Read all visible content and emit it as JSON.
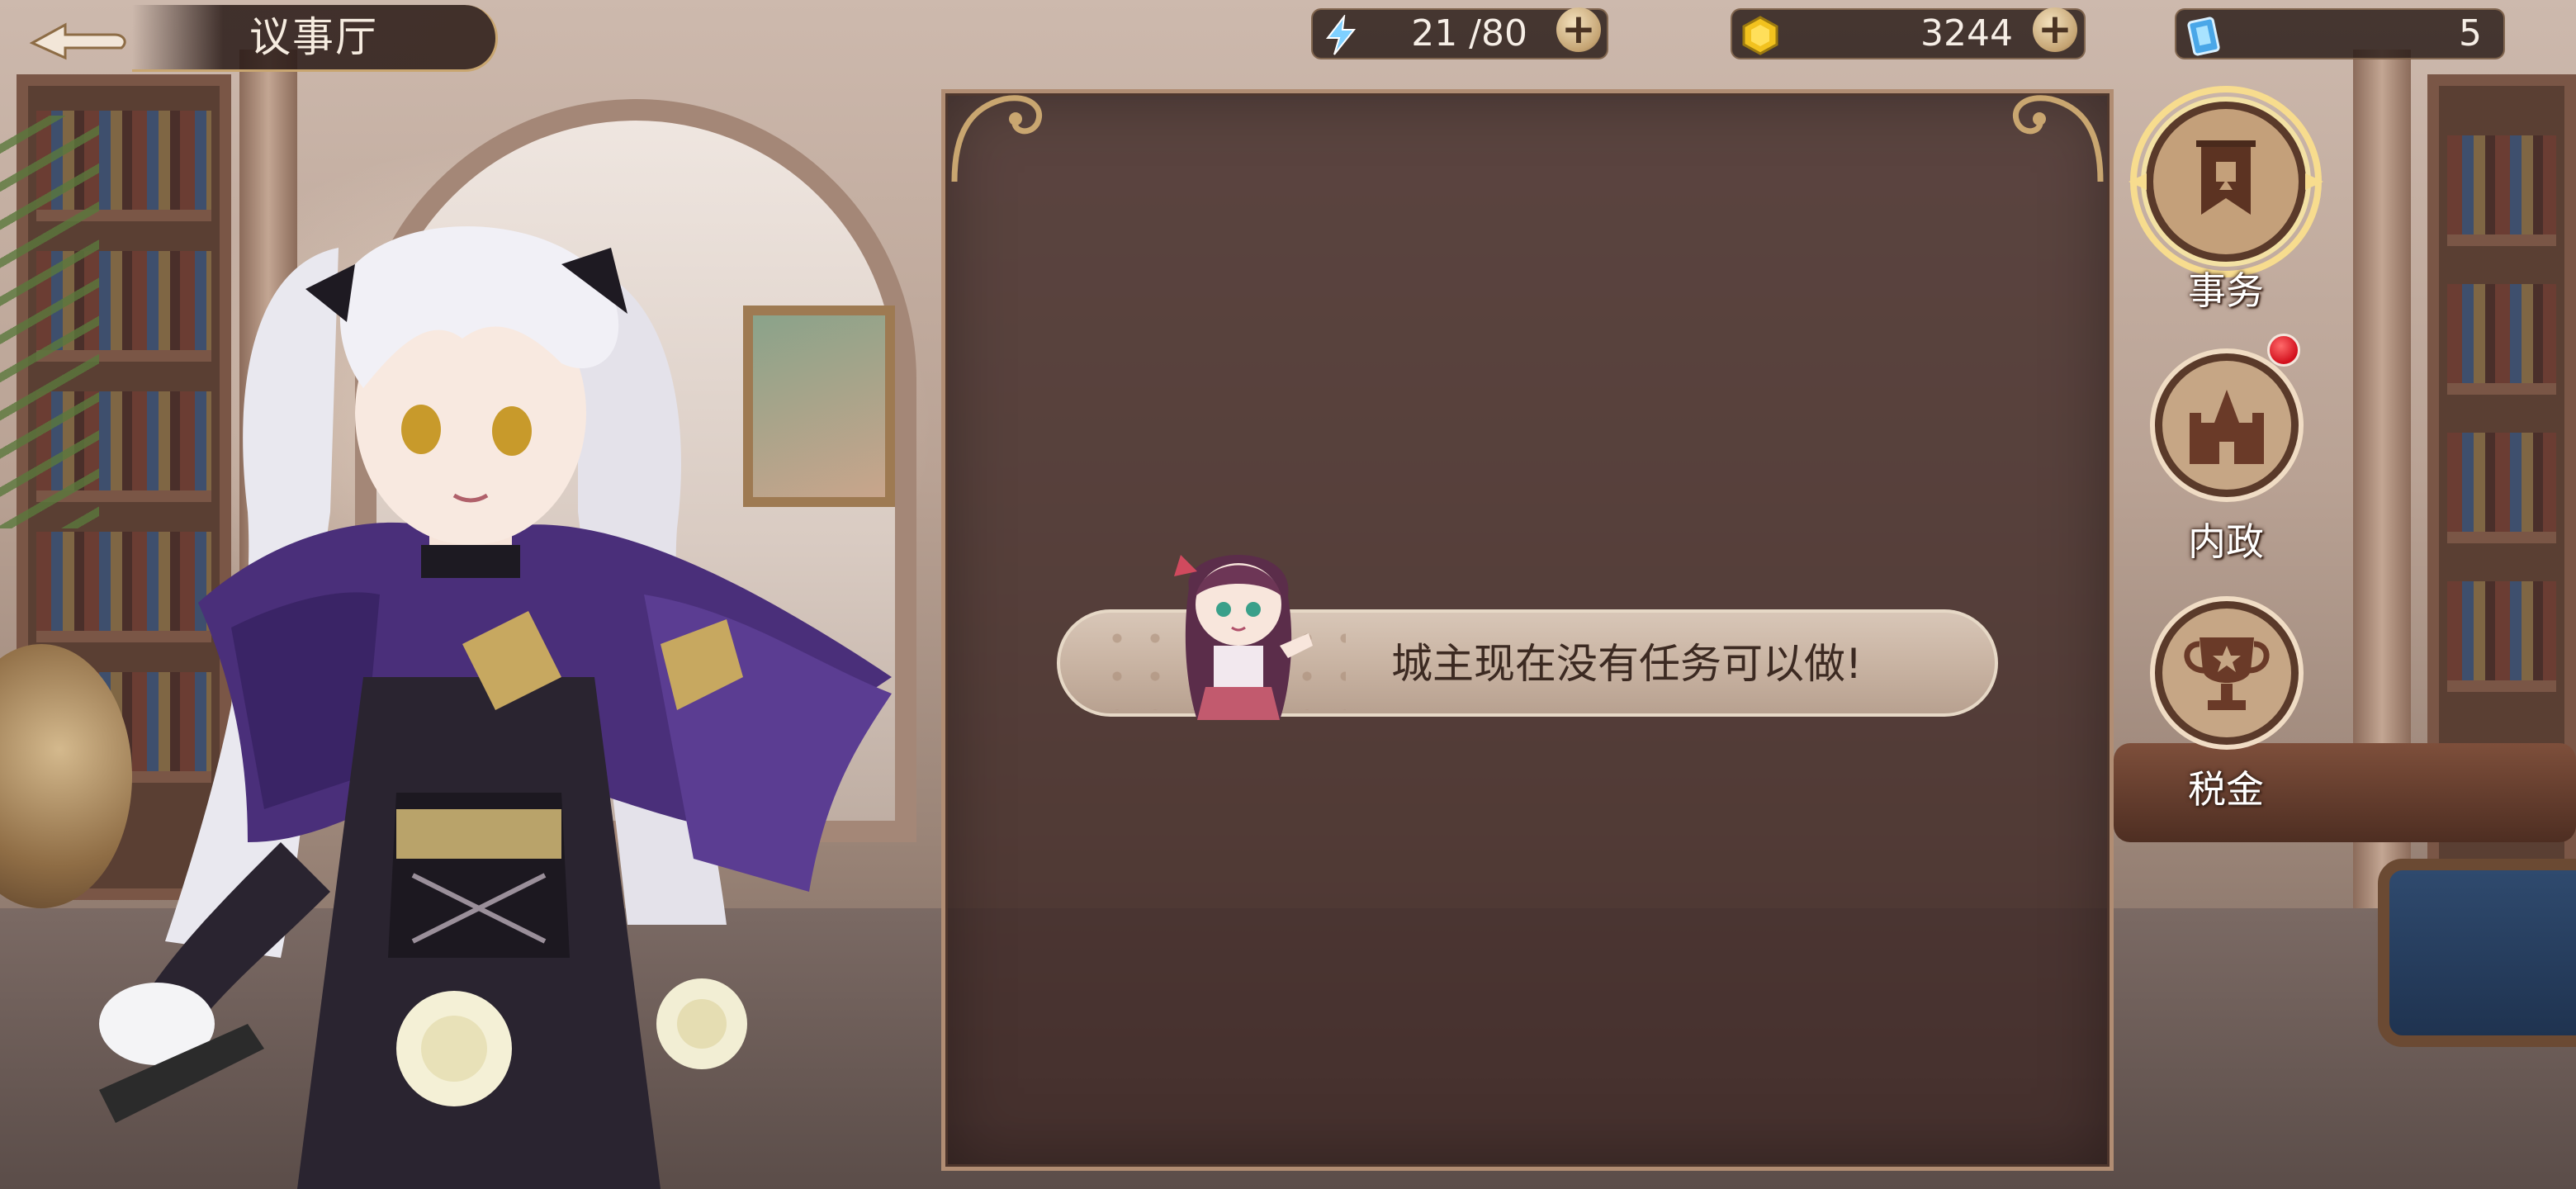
{
  "page": {
    "title": "议事厅"
  },
  "resources": {
    "stamina": {
      "icon": "lightning-icon",
      "value": "21 /80"
    },
    "gold": {
      "icon": "gold-coin-icon",
      "value": "3244"
    },
    "tickets": {
      "icon": "ticket-card-icon",
      "value": "5"
    }
  },
  "panel": {
    "message": "城主现在没有任务可以做!"
  },
  "side_menu": [
    {
      "label": "事务",
      "icon": "banner-icon",
      "selected": true,
      "badge": false
    },
    {
      "label": "内政",
      "icon": "castle-icon",
      "selected": false,
      "badge": true
    },
    {
      "label": "税金",
      "icon": "trophy-icon",
      "selected": false,
      "badge": false
    }
  ],
  "colors": {
    "accent_gold": "#c9a670",
    "panel_bg": "#3e2826",
    "badge_red": "#d20f1c"
  }
}
